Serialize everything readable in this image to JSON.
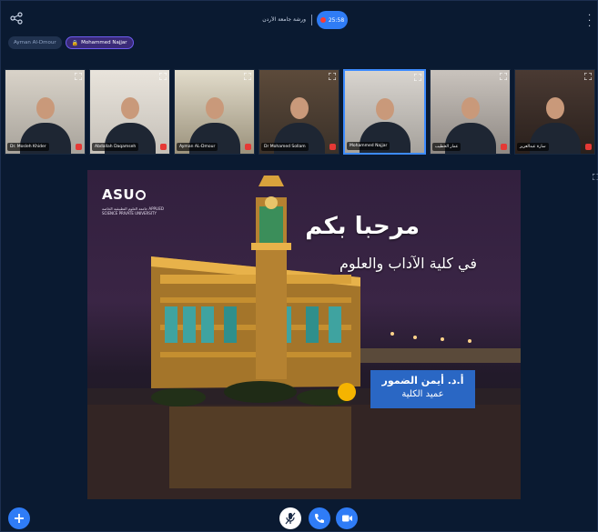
{
  "meeting": {
    "title": "ورشة جامعة الأردن",
    "timer": "25:58"
  },
  "chips": [
    {
      "label": "Ayman Al-Dmour"
    },
    {
      "label": "Mohammed Najjar"
    }
  ],
  "participants": [
    {
      "name": "Dr. Mosleh Khider"
    },
    {
      "name": "Abdallah Daqamseh"
    },
    {
      "name": "Ayman AL-Dmour"
    },
    {
      "name": "Dr Mohamed Sollam"
    },
    {
      "name": "Mohammed Najjar"
    },
    {
      "name": "عمار الخطيب"
    },
    {
      "name": "سارة عبدالعزيز"
    }
  ],
  "slide": {
    "logo": "ASU",
    "university": "جامعة العلوم التطبيقية الخاصة APPLIED SCIENCE PRIVATE UNIVERSITY",
    "welcome": "مرحبا بكم",
    "college": "في كلية الآداب والعلوم",
    "dean_name": "أ.د. أيمن الضمور",
    "dean_title": "عميد الكلية"
  },
  "colors": {
    "accent": "#2f7cf6",
    "active_chip": "#3a2a78",
    "record": "#ff3b30",
    "dean_box": "#2a67c4",
    "mute": "#e53935"
  },
  "icons": {
    "share": "share-icon",
    "lock": "lock-icon",
    "add": "plus-icon",
    "mic": "microphone-icon",
    "phone": "phone-icon",
    "camera": "camera-icon",
    "more": "kebab-menu-icon",
    "expand": "expand-icon"
  }
}
